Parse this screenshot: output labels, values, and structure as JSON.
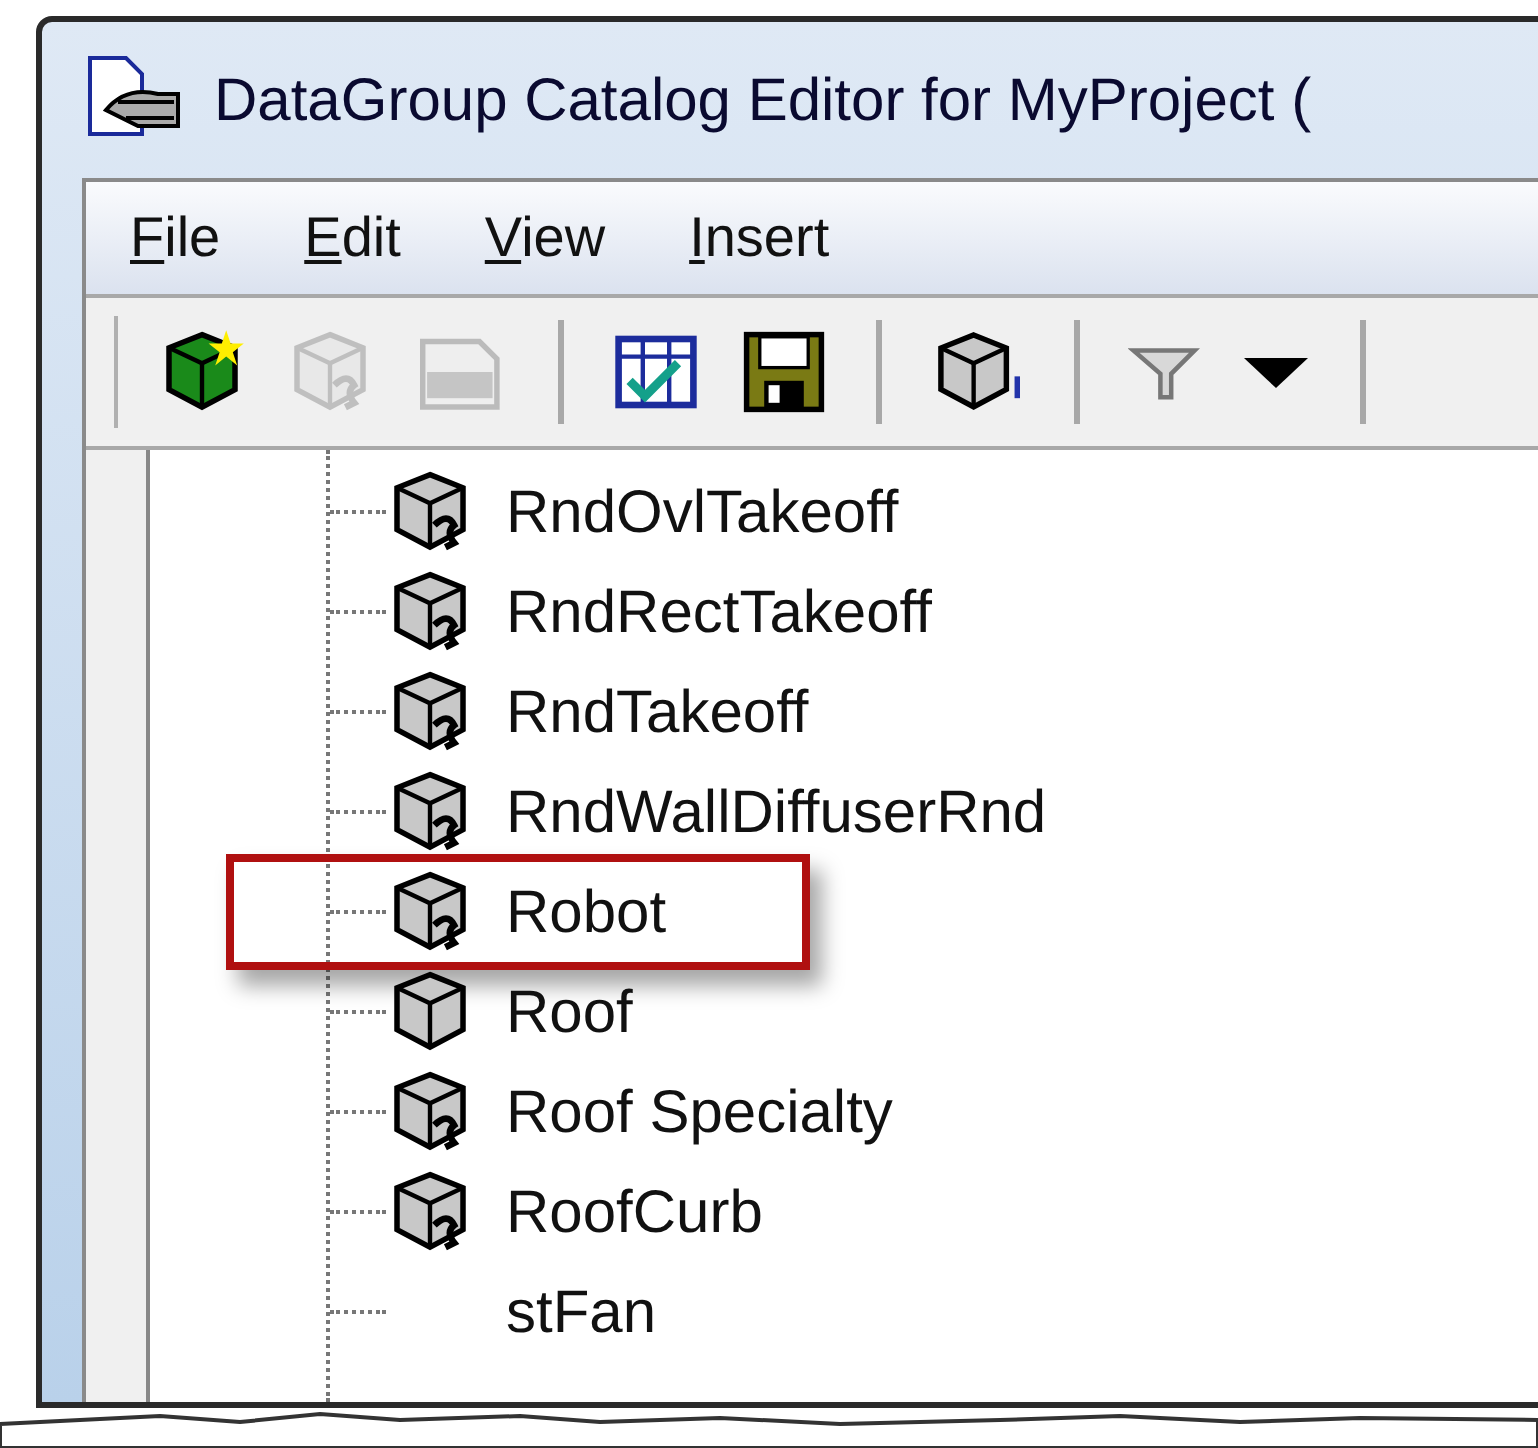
{
  "window": {
    "title": "DataGroup Catalog Editor for MyProject ("
  },
  "menu": [
    {
      "label": "File"
    },
    {
      "label": "Edit"
    },
    {
      "label": "View"
    },
    {
      "label": "Insert"
    }
  ],
  "toolbar": [
    {
      "kind": "new",
      "disabled": false
    },
    {
      "kind": "cube-edit",
      "disabled": true
    },
    {
      "kind": "xsd",
      "disabled": true
    },
    {
      "kind": "separator"
    },
    {
      "kind": "grid-check",
      "disabled": false
    },
    {
      "kind": "save",
      "disabled": false
    },
    {
      "kind": "separator"
    },
    {
      "kind": "cube",
      "disabled": false
    },
    {
      "kind": "separator"
    },
    {
      "kind": "filter",
      "disabled": false
    },
    {
      "kind": "dropdown",
      "disabled": false
    },
    {
      "kind": "separator"
    }
  ],
  "tree": [
    {
      "label": "RndOvlTakeoff",
      "kind": "component",
      "highlighted": false
    },
    {
      "label": "RndRectTakeoff",
      "kind": "component",
      "highlighted": false
    },
    {
      "label": "RndTakeoff",
      "kind": "component",
      "highlighted": false
    },
    {
      "label": "RndWallDiffuserRnd",
      "kind": "component",
      "highlighted": false
    },
    {
      "label": "Robot",
      "kind": "component",
      "highlighted": true
    },
    {
      "label": "Roof",
      "kind": "solid",
      "highlighted": false
    },
    {
      "label": "Roof Specialty",
      "kind": "component",
      "highlighted": false
    },
    {
      "label": "RoofCurb",
      "kind": "component",
      "highlighted": false
    },
    {
      "label": "stFan",
      "kind": "partial",
      "highlighted": false
    }
  ]
}
